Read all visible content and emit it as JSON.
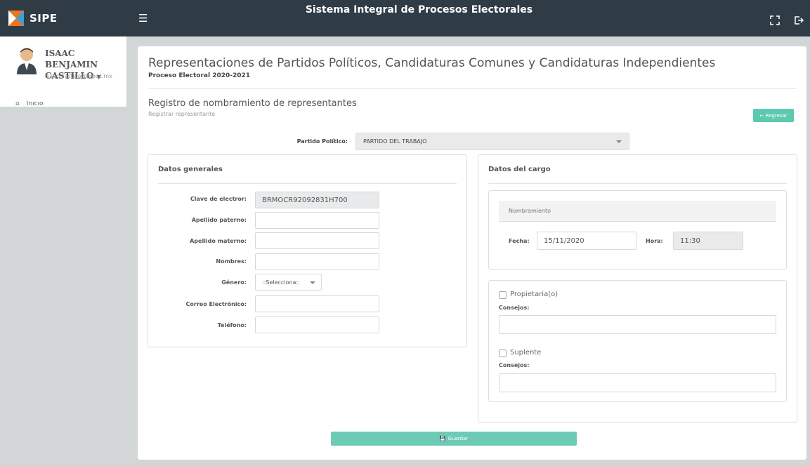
{
  "header": {
    "brand": "SIPE",
    "title": "Sistema Integral de Procesos Electorales",
    "menu_icon": "hamburger-icon",
    "fullscreen_icon": "fullscreen-icon",
    "logout_icon": "logout-icon"
  },
  "sidebar": {
    "user_first": "ISAAC BENJAMIN",
    "user_last": "CASTILLO",
    "email": "isaac.castillo@iepac.mx",
    "nav": [
      {
        "label": "Inicio",
        "icon": "home-icon"
      }
    ]
  },
  "page": {
    "title": "Representaciones de Partidos Políticos, Candidaturas Comunes y Candidaturas Independientes",
    "subtitle": "Proceso Electoral 2020-2021",
    "section_title": "Registro de nombramiento de representantes",
    "section_sub": "Registrar representante",
    "back_label": "Regresar"
  },
  "party": {
    "label": "Partido Político:",
    "value": "PARTIDO DEL TRABAJO"
  },
  "general": {
    "title": "Datos generales",
    "fields": {
      "clave": {
        "label": "Clave de electror:",
        "value": "BRMOCR92092831H700"
      },
      "paterno": {
        "label": "Apellido paterno:",
        "value": ""
      },
      "materno": {
        "label": "Apellido materno:",
        "value": ""
      },
      "nombres": {
        "label": "Nombres:",
        "value": ""
      },
      "genero": {
        "label": "Género:",
        "value": "::Selecciona::"
      },
      "correo": {
        "label": "Correo Electrónico:",
        "value": ""
      },
      "telefono": {
        "label": "Teléfono:",
        "value": ""
      }
    }
  },
  "cargo": {
    "title": "Datos del cargo",
    "nombramiento": "Nombramiento",
    "fecha_label": "Fecha:",
    "fecha": "15/11/2020",
    "hora_label": "Hora:",
    "hora": "11:30",
    "propietario": {
      "label": "Propietaria(o)",
      "checked": false,
      "consejos_label": "Consejos:",
      "consejos": ""
    },
    "suplente": {
      "label": "Suplente",
      "checked": false,
      "consejos_label": "Consejos:",
      "consejos": ""
    }
  },
  "save_label": "Guardar",
  "colors": {
    "topbar": "#2f3b45",
    "accent": "#5dc9b0",
    "background": "#d2d6d7"
  }
}
